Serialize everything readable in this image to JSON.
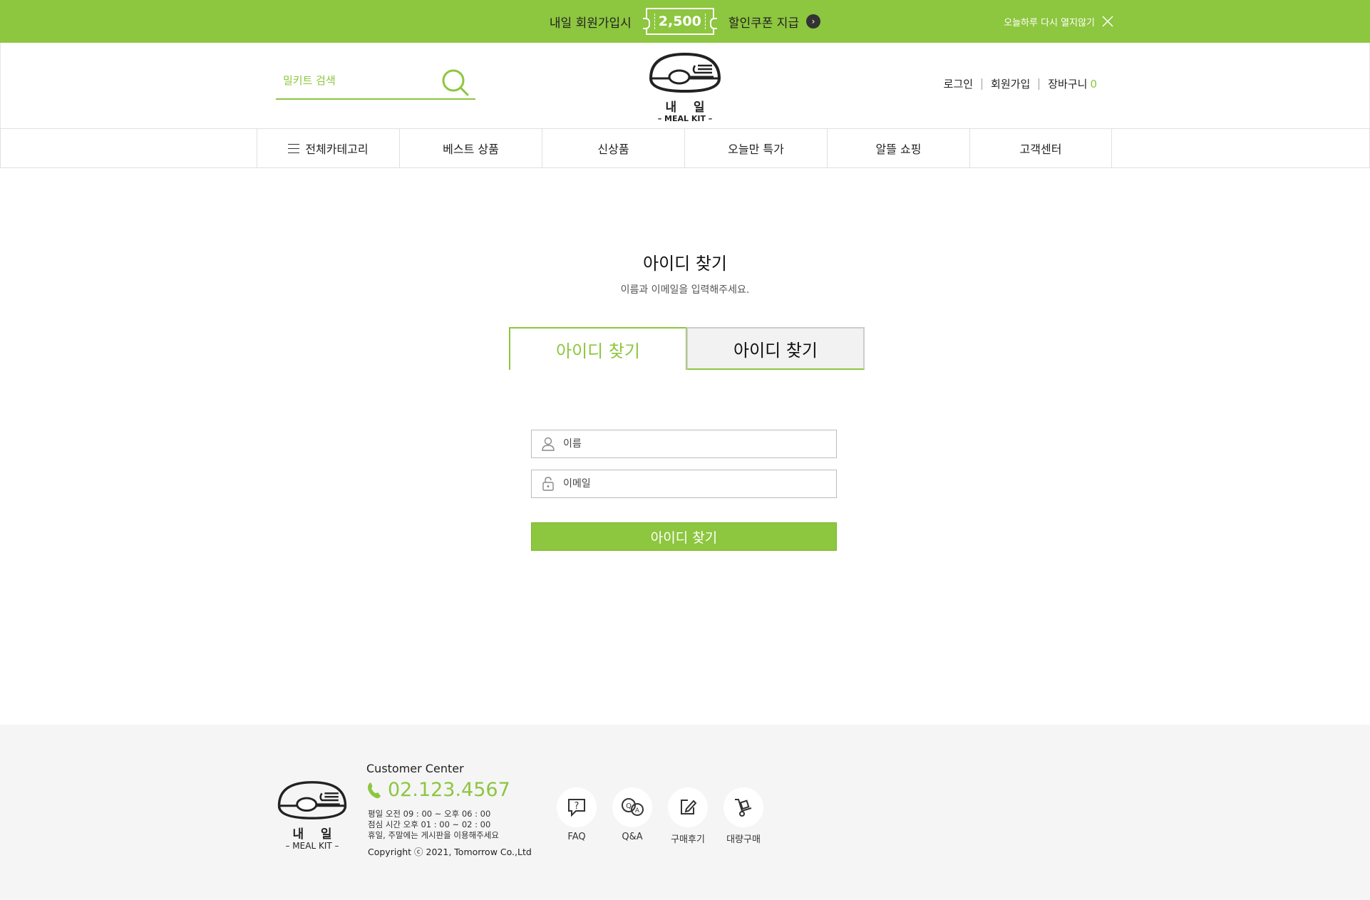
{
  "colors": {
    "accent": "#8dc63f",
    "footer_bg": "#f5f5f5"
  },
  "promo": {
    "text_before": "내일 회원가입시",
    "coupon_amount": "2,500",
    "text_after": "할인쿠폰 지급",
    "arrow_icon": "chevron-right",
    "close_text": "오늘하루 다시 열지않기"
  },
  "header": {
    "search_placeholder": "밀키트 검색",
    "logo": {
      "brand": "내    일",
      "sub": "– MEAL KIT –"
    },
    "util": {
      "login": "로그인",
      "signup": "회원가입",
      "cart": "장바구니",
      "cart_count": "0"
    }
  },
  "nav": {
    "items": [
      "전체카테고리",
      "베스트 상품",
      "신상품",
      "오늘만 특가",
      "알뜰 쇼핑",
      "고객센터"
    ]
  },
  "main": {
    "title": "아이디 찾기",
    "subtitle": "이름과 이메일을 입력해주세요.",
    "tabs": [
      "아이디 찾기",
      "아이디 찾기"
    ],
    "name_placeholder": "이름",
    "email_placeholder": "이메일",
    "submit_label": "아이디 찾기"
  },
  "footer": {
    "logo": {
      "brand": "내    일",
      "sub": "– MEAL KIT –"
    },
    "cc_label": "Customer Center",
    "phone": "02.123.4567",
    "hours": [
      "평일 오전 09 : 00 ~ 오후 06 : 00",
      "점심 시간 오후 01 : 00 ~ 02 : 00",
      "휴일, 주말에는 게시판을 이용해주세요"
    ],
    "copyright": "Copyright ⓒ 2021, Tomorrow Co.,Ltd",
    "quick_links": [
      "FAQ",
      "Q&A",
      "구매후기",
      "대량구매"
    ]
  }
}
